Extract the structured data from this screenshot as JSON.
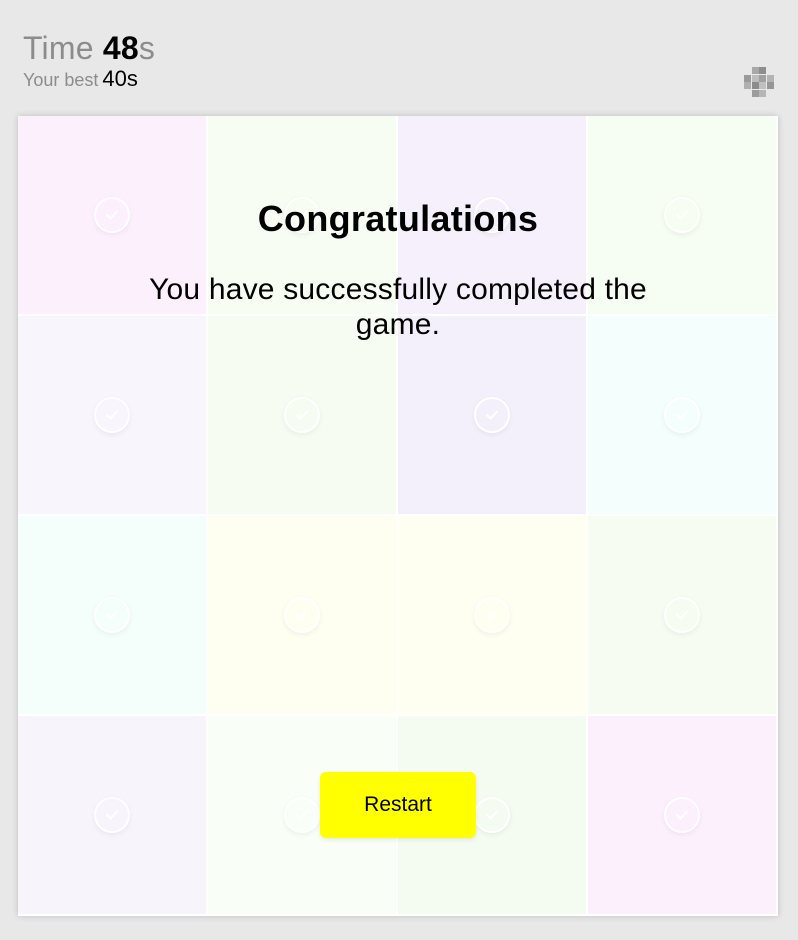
{
  "header": {
    "time_label": "Time",
    "time_value": "48",
    "time_unit": "s",
    "best_label": "Your best",
    "best_value": "40s"
  },
  "settings_icon": "grid-pattern-icon",
  "board": {
    "tiles": [
      {
        "color": "#fdf0fd"
      },
      {
        "color": "#f7fdf2"
      },
      {
        "color": "#f5f0fb"
      },
      {
        "color": "#f6fdf2"
      },
      {
        "color": "#f8f5fc"
      },
      {
        "color": "#f7fcf3"
      },
      {
        "color": "#f4f0fb"
      },
      {
        "color": "#f4fefc"
      },
      {
        "color": "#f4fffb"
      },
      {
        "color": "#fefff1"
      },
      {
        "color": "#fffff1"
      },
      {
        "color": "#f6fcf2"
      },
      {
        "color": "#f8f4fc"
      },
      {
        "color": "#f9fff6"
      },
      {
        "color": "#f4fbf1"
      },
      {
        "color": "#fdf0fd"
      }
    ],
    "tile_icon": "check-circle-icon"
  },
  "overlay": {
    "title": "Congratulations",
    "message": "You have successfully completed the game.",
    "restart_label": "Restart",
    "restart_color": "#ffff00"
  }
}
